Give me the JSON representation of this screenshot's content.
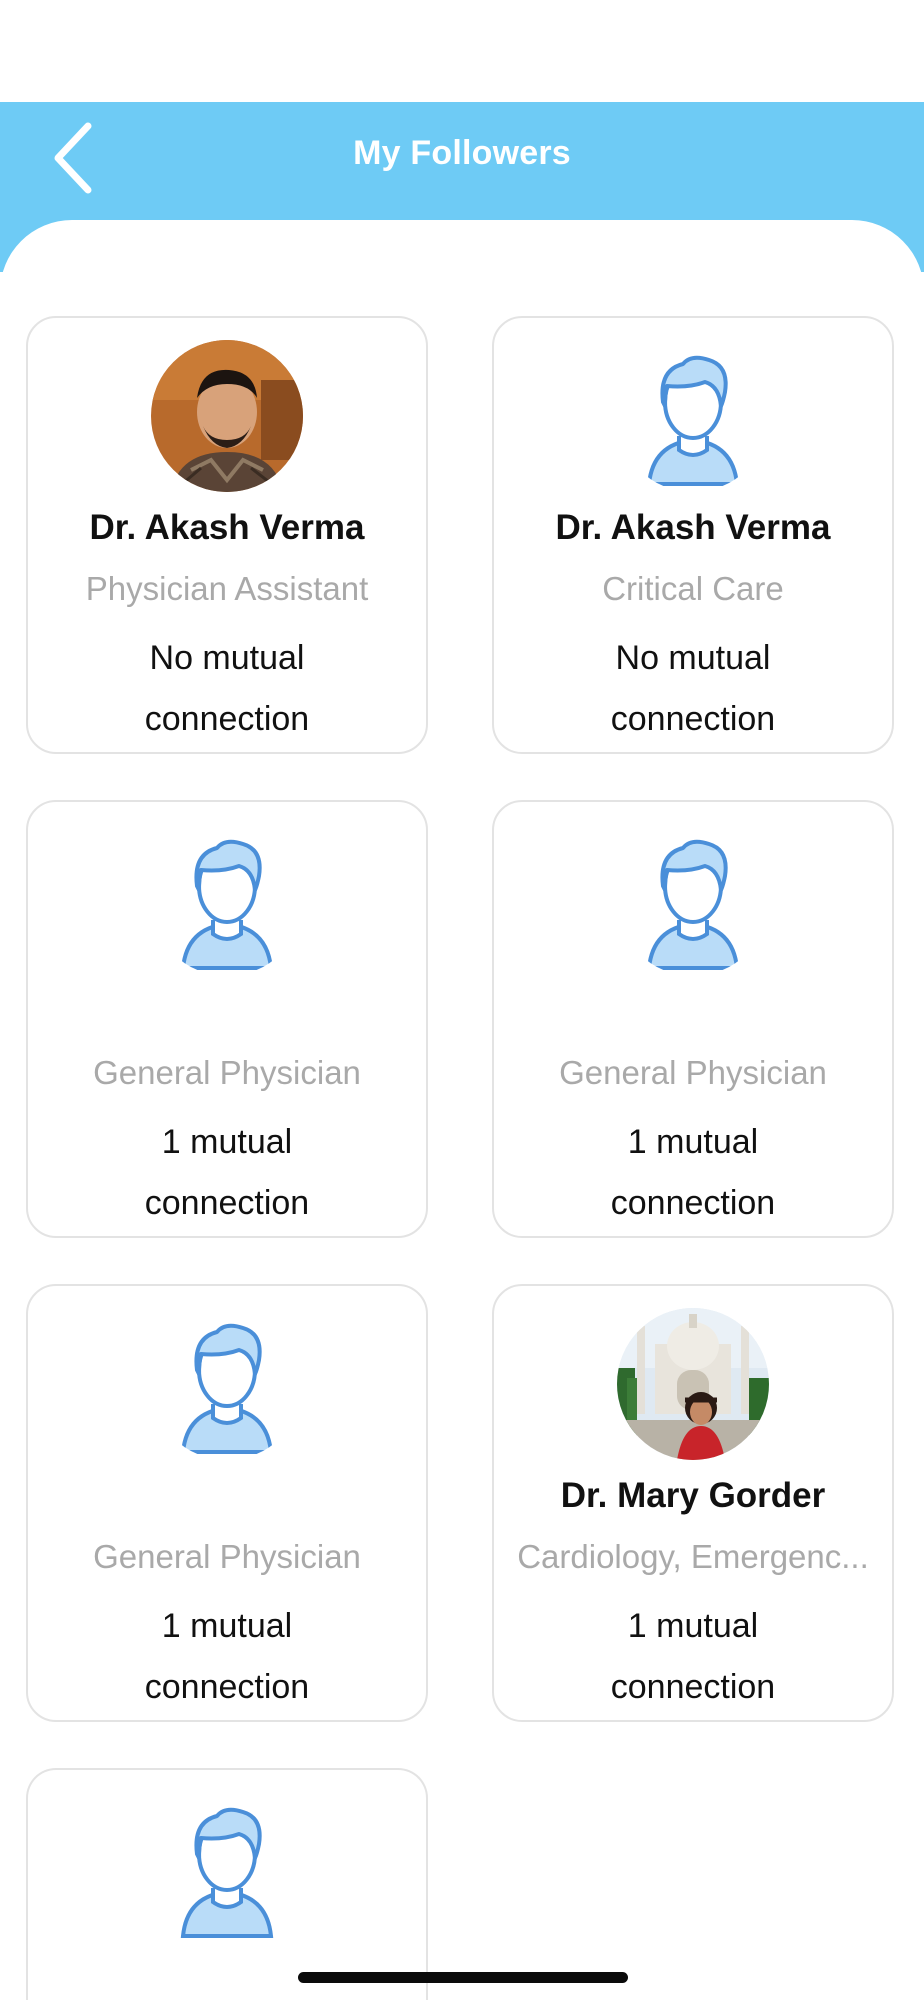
{
  "header": {
    "title": "My Followers",
    "background_color": "#6ecbf5",
    "back_icon": "chevron-left-icon"
  },
  "followers": [
    {
      "name": "Dr. Akash Verma",
      "specialty": "Physician Assistant",
      "mutual_line1": "No mutual",
      "mutual_line2": "connection",
      "avatar": "photo-man"
    },
    {
      "name": "Dr. Akash Verma",
      "specialty": "Critical Care",
      "mutual_line1": "No mutual",
      "mutual_line2": "connection",
      "avatar": "default-user-icon"
    },
    {
      "name": "",
      "specialty": "General Physician",
      "mutual_line1": "1 mutual",
      "mutual_line2": "connection",
      "avatar": "default-user-icon"
    },
    {
      "name": "",
      "specialty": "General Physician",
      "mutual_line1": "1 mutual",
      "mutual_line2": "connection",
      "avatar": "default-user-icon"
    },
    {
      "name": "",
      "specialty": "General Physician",
      "mutual_line1": "1 mutual",
      "mutual_line2": "connection",
      "avatar": "default-user-icon"
    },
    {
      "name": "Dr. Mary Gorder",
      "specialty": "Cardiology, Emergenc...",
      "mutual_line1": "1 mutual",
      "mutual_line2": "connection",
      "avatar": "photo-taj-mahal"
    },
    {
      "name": "",
      "specialty": "",
      "mutual_line1": "",
      "mutual_line2": "",
      "avatar": "default-user-icon"
    }
  ],
  "colors": {
    "accent": "#6ecbf5",
    "avatar_blue": "#4a8fd9",
    "avatar_fill": "#b9dcf8",
    "muted_text": "#a9a9a9"
  }
}
